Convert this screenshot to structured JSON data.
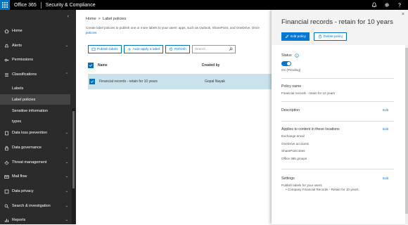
{
  "topbar": {
    "app_name": "Office 365",
    "suite_name": "Security & Compliance",
    "icons": [
      "waffle-icon",
      "bell-icon",
      "gear-icon",
      "help-icon"
    ]
  },
  "nav": {
    "collapse_glyph": "‹",
    "items": [
      {
        "label": "Home",
        "icon": "home-icon"
      },
      {
        "label": "Alerts",
        "icon": "alert-icon"
      },
      {
        "label": "Permissions",
        "icon": "key-icon"
      },
      {
        "label": "Classifications",
        "icon": "classification-icon"
      },
      {
        "label": "Data loss prevention",
        "icon": "dlp-icon"
      },
      {
        "label": "Data governance",
        "icon": "lock-icon"
      },
      {
        "label": "Threat management",
        "icon": "threat-icon"
      },
      {
        "label": "Mail flow",
        "icon": "mail-icon"
      },
      {
        "label": "Data privacy",
        "icon": "privacy-icon"
      },
      {
        "label": "Search & investigation",
        "icon": "search-icon"
      },
      {
        "label": "Reports",
        "icon": "reports-icon"
      }
    ],
    "sub_items": [
      "Labels",
      "Label policies",
      "Sensitive information",
      "types"
    ]
  },
  "main": {
    "breadcrumb": {
      "home": "Home",
      "sep": ">",
      "current": "Label policies"
    },
    "intro_text": "Create label policies to publish one or more labels to your users' apps, such as Outlook, SharePoint, and OneDrive. Once",
    "intro_link": "policies",
    "toolbar": {
      "publish": "Publish labels",
      "auto_apply": "Auto-apply a label",
      "refresh": "Refresh",
      "search_placeholder": "Search"
    },
    "table": {
      "columns": [
        "Name",
        "Created by"
      ],
      "rows": [
        {
          "name": "Financial records - retain for 10 years",
          "created_by": "Gopal Nayak"
        }
      ]
    }
  },
  "panel": {
    "title": "Financial records - retain for 10 years",
    "close_glyph": "×",
    "edit_btn": "Edit policy",
    "delete_btn": "Delete policy",
    "status_label": "Status",
    "status_value": "On (Pending)",
    "policy_name_label": "Policy name",
    "policy_name_value": "Financial records - retain for 10 years",
    "description_label": "Description",
    "edit_link": "Edit",
    "applies_label": "Applies to content in these locations",
    "locations": [
      "Exchange email",
      "OneDrive accounts",
      "SharePoint sites",
      "Office 365 groups"
    ],
    "settings_label": "Settings",
    "settings_text": "Publish labels for your users",
    "settings_bullet": "Company Financial Records - Retain for 10 years"
  },
  "colors": {
    "accent": "#0078d7",
    "nav_bg": "#2b2b2b",
    "selected_row": "#c9e3ec"
  }
}
